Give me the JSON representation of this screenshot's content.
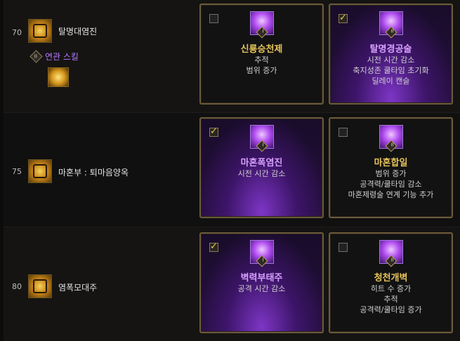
{
  "rows": [
    {
      "level": "70",
      "skill_name": "탈명대염진",
      "related_label": "연관 스킬",
      "related_badge": "II",
      "options": [
        {
          "tier": "I",
          "checked": false,
          "title": "신룡승천제",
          "lines": [
            "추적",
            "범위 증가"
          ]
        },
        {
          "tier": "II",
          "checked": true,
          "title": "탈명경공술",
          "lines": [
            "시전 시간 감소",
            "축지성존 쿨타임 초기화",
            "딜레이 캔슬"
          ]
        }
      ]
    },
    {
      "level": "75",
      "skill_name": "마혼부 : 퇴마음양옥",
      "options": [
        {
          "tier": "I",
          "checked": true,
          "title": "마혼폭염진",
          "lines": [
            "시전 시간 감소"
          ]
        },
        {
          "tier": "II",
          "checked": false,
          "title": "마혼합일",
          "lines": [
            "범위 증가",
            "공격력/쿨타임 감소",
            "마혼제령술 연계 기능 추가"
          ]
        }
      ]
    },
    {
      "level": "80",
      "skill_name": "염폭모대주",
      "options": [
        {
          "tier": "I",
          "checked": true,
          "title": "벽력부태주",
          "lines": [
            "공격 시간 감소"
          ]
        },
        {
          "tier": "II",
          "checked": false,
          "title": "청천개벽",
          "lines": [
            "히트 수 증가",
            "추적",
            "공격력/쿨타임 증가"
          ]
        }
      ]
    }
  ]
}
